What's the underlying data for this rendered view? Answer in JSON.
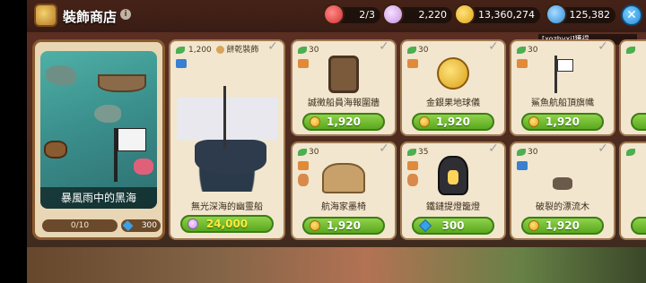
{
  "header": {
    "title": "裝飾商店",
    "info_icon": "info-icon"
  },
  "resources": {
    "hearts": "2/3",
    "cotton": "2,220",
    "coins": "13,360,274",
    "gems": "125,382"
  },
  "chat": {
    "text": "[xozhyxj]獲得"
  },
  "featured": {
    "name": "暴風雨中的黑海",
    "progress": "0/10",
    "gem_count": "300"
  },
  "cards": [
    {
      "tag": "1,200",
      "extra_tag": "餅乾裝飾",
      "name": "無光深海的幽靈船",
      "price": "24,000",
      "currency": "cotton"
    },
    {
      "tag": "30",
      "name": "誠徵船員海報圍牆",
      "price": "1,920",
      "currency": "coin"
    },
    {
      "tag": "30",
      "name": "金銀果地球儀",
      "price": "1,920",
      "currency": "coin"
    },
    {
      "tag": "30",
      "name": "鯊魚航船頂旗幟",
      "price": "1,920",
      "currency": "coin"
    },
    {
      "tag": "30",
      "name": "航海家墨椅",
      "price": "1,920",
      "currency": "coin"
    },
    {
      "tag": "35",
      "name": "鐵鏈提燈籠燈",
      "price": "300",
      "currency": "gem"
    },
    {
      "tag": "30",
      "name": "破裂的漂流木",
      "price": "1,920",
      "currency": "coin"
    }
  ],
  "colors": {
    "buy_button": "#5aa81e",
    "panel": "#f2e6cf",
    "frame": "#a07a52"
  }
}
